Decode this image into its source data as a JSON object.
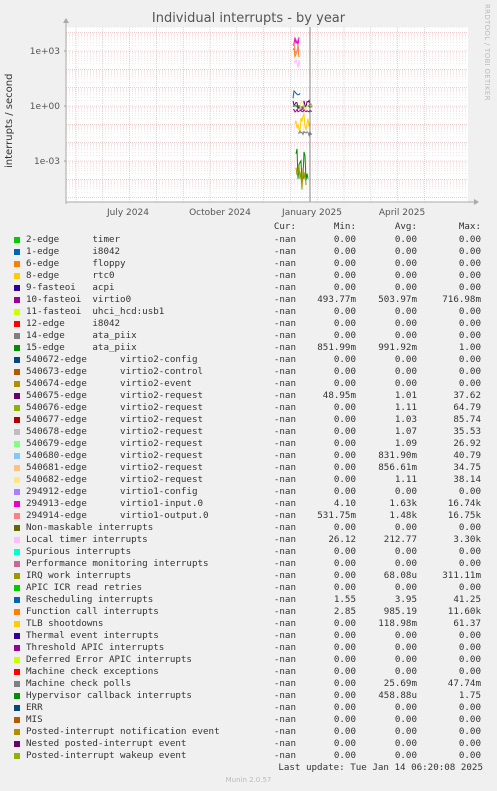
{
  "title": "Individual interrupts - by year",
  "ylabel": "interrupts / second",
  "side_label": "RRDTOOL / TOBI OETIKER",
  "header": {
    "cur": "Cur:",
    "min": "Min:",
    "avg": "Avg:",
    "max": "Max:"
  },
  "last_update": "Last update: Tue Jan 14 06:20:08 2025",
  "munin": "Munin 2.0.57",
  "chart_data": {
    "type": "line",
    "title": "Individual interrupts - by year",
    "ylabel": "interrupts / second",
    "yscale": "log",
    "ylim": [
      5e-05,
      100000
    ],
    "yticks": [
      "1e+03",
      "1e+00",
      "1e-03"
    ],
    "xticks": [
      "July 2024",
      "October 2024",
      "January 2025",
      "April 2025"
    ],
    "grid": true,
    "series": [
      {
        "name": "2-edge timer",
        "color": "#00cc00",
        "cur": "-nan",
        "min": "0.00",
        "avg": "0.00",
        "max": "0.00"
      },
      {
        "name": "1-edge i8042",
        "color": "#0066b3",
        "cur": "-nan",
        "min": "0.00",
        "avg": "0.00",
        "max": "0.00"
      },
      {
        "name": "6-edge floppy",
        "color": "#ff8000",
        "cur": "-nan",
        "min": "0.00",
        "avg": "0.00",
        "max": "0.00"
      },
      {
        "name": "8-edge rtc0",
        "color": "#ffcc00",
        "cur": "-nan",
        "min": "0.00",
        "avg": "0.00",
        "max": "0.00"
      },
      {
        "name": "9-fasteoi acpi",
        "color": "#330099",
        "cur": "-nan",
        "min": "0.00",
        "avg": "0.00",
        "max": "0.00"
      },
      {
        "name": "10-fasteoi virtio0",
        "color": "#990099",
        "cur": "-nan",
        "min": "493.77m",
        "avg": "503.97m",
        "max": "716.98m"
      },
      {
        "name": "11-fasteoi uhci_hcd:usb1",
        "color": "#ccff00",
        "cur": "-nan",
        "min": "0.00",
        "avg": "0.00",
        "max": "0.00"
      },
      {
        "name": "12-edge i8042",
        "color": "#ff0000",
        "cur": "-nan",
        "min": "0.00",
        "avg": "0.00",
        "max": "0.00"
      },
      {
        "name": "14-edge ata_piix",
        "color": "#808080",
        "cur": "-nan",
        "min": "0.00",
        "avg": "0.00",
        "max": "0.00"
      },
      {
        "name": "15-edge ata_piix",
        "color": "#008f00",
        "cur": "-nan",
        "min": "851.99m",
        "avg": "991.92m",
        "max": "1.00"
      },
      {
        "name": "540672-edge virtio2-config",
        "color": "#00487d",
        "cur": "-nan",
        "min": "0.00",
        "avg": "0.00",
        "max": "0.00"
      },
      {
        "name": "540673-edge virtio2-control",
        "color": "#b35a00",
        "cur": "-nan",
        "min": "0.00",
        "avg": "0.00",
        "max": "0.00"
      },
      {
        "name": "540674-edge virtio2-event",
        "color": "#b38f00",
        "cur": "-nan",
        "min": "0.00",
        "avg": "0.00",
        "max": "0.00"
      },
      {
        "name": "540675-edge virtio2-request",
        "color": "#6b006b",
        "cur": "-nan",
        "min": "48.95m",
        "avg": "1.01",
        "max": "37.62"
      },
      {
        "name": "540676-edge virtio2-request",
        "color": "#8fb300",
        "cur": "-nan",
        "min": "0.00",
        "avg": "1.11",
        "max": "64.79"
      },
      {
        "name": "540677-edge virtio2-request",
        "color": "#b30000",
        "cur": "-nan",
        "min": "0.00",
        "avg": "1.03",
        "max": "85.74"
      },
      {
        "name": "540678-edge virtio2-request",
        "color": "#bebebe",
        "cur": "-nan",
        "min": "0.00",
        "avg": "1.07",
        "max": "35.53"
      },
      {
        "name": "540679-edge virtio2-request",
        "color": "#80ff80",
        "cur": "-nan",
        "min": "0.00",
        "avg": "1.09",
        "max": "26.92"
      },
      {
        "name": "540680-edge virtio2-request",
        "color": "#80c9ff",
        "cur": "-nan",
        "min": "0.00",
        "avg": "831.90m",
        "max": "40.79"
      },
      {
        "name": "540681-edge virtio2-request",
        "color": "#ffc080",
        "cur": "-nan",
        "min": "0.00",
        "avg": "856.61m",
        "max": "34.75"
      },
      {
        "name": "540682-edge virtio2-request",
        "color": "#ffe680",
        "cur": "-nan",
        "min": "0.00",
        "avg": "1.11",
        "max": "38.14"
      },
      {
        "name": "294912-edge virtio1-config",
        "color": "#aa80ff",
        "cur": "-nan",
        "min": "0.00",
        "avg": "0.00",
        "max": "0.00"
      },
      {
        "name": "294913-edge virtio1-input.0",
        "color": "#ee00cc",
        "cur": "-nan",
        "min": "4.10",
        "avg": "1.63k",
        "max": "16.74k"
      },
      {
        "name": "294914-edge virtio1-output.0",
        "color": "#ff8080",
        "cur": "-nan",
        "min": "531.75m",
        "avg": "1.48k",
        "max": "16.75k"
      },
      {
        "name": "Non-maskable interrupts",
        "color": "#666600",
        "cur": "-nan",
        "min": "0.00",
        "avg": "0.00",
        "max": "0.00"
      },
      {
        "name": "Local timer interrupts",
        "color": "#ffbfff",
        "cur": "-nan",
        "min": "26.12",
        "avg": "212.77",
        "max": "3.30k"
      },
      {
        "name": "Spurious interrupts",
        "color": "#00ffcc",
        "cur": "-nan",
        "min": "0.00",
        "avg": "0.00",
        "max": "0.00"
      },
      {
        "name": "Performance monitoring interrupts",
        "color": "#cc6699",
        "cur": "-nan",
        "min": "0.00",
        "avg": "0.00",
        "max": "0.00"
      },
      {
        "name": "IRQ work interrupts",
        "color": "#999900",
        "cur": "-nan",
        "min": "0.00",
        "avg": "68.08u",
        "max": "311.11m"
      },
      {
        "name": "APIC ICR read retries",
        "color": "#00cc00",
        "cur": "-nan",
        "min": "0.00",
        "avg": "0.00",
        "max": "0.00"
      },
      {
        "name": "Rescheduling interrupts",
        "color": "#0066b3",
        "cur": "-nan",
        "min": "1.55",
        "avg": "3.95",
        "max": "41.25"
      },
      {
        "name": "Function call interrupts",
        "color": "#ff8000",
        "cur": "-nan",
        "min": "2.85",
        "avg": "985.19",
        "max": "11.60k"
      },
      {
        "name": "TLB shootdowns",
        "color": "#ffcc00",
        "cur": "-nan",
        "min": "0.00",
        "avg": "118.98m",
        "max": "61.37"
      },
      {
        "name": "Thermal event interrupts",
        "color": "#330099",
        "cur": "-nan",
        "min": "0.00",
        "avg": "0.00",
        "max": "0.00"
      },
      {
        "name": "Threshold APIC interrupts",
        "color": "#990099",
        "cur": "-nan",
        "min": "0.00",
        "avg": "0.00",
        "max": "0.00"
      },
      {
        "name": "Deferred Error APIC interrupts",
        "color": "#ccff00",
        "cur": "-nan",
        "min": "0.00",
        "avg": "0.00",
        "max": "0.00"
      },
      {
        "name": "Machine check exceptions",
        "color": "#ff0000",
        "cur": "-nan",
        "min": "0.00",
        "avg": "0.00",
        "max": "0.00"
      },
      {
        "name": "Machine check polls",
        "color": "#808080",
        "cur": "-nan",
        "min": "0.00",
        "avg": "25.69m",
        "max": "47.74m"
      },
      {
        "name": "Hypervisor callback interrupts",
        "color": "#008f00",
        "cur": "-nan",
        "min": "0.00",
        "avg": "458.88u",
        "max": "1.75"
      },
      {
        "name": "ERR",
        "color": "#00487d",
        "cur": "-nan",
        "min": "0.00",
        "avg": "0.00",
        "max": "0.00"
      },
      {
        "name": "MIS",
        "color": "#b35a00",
        "cur": "-nan",
        "min": "0.00",
        "avg": "0.00",
        "max": "0.00"
      },
      {
        "name": "Posted-interrupt notification event",
        "color": "#b38f00",
        "cur": "-nan",
        "min": "0.00",
        "avg": "0.00",
        "max": "0.00"
      },
      {
        "name": "Nested posted-interrupt event",
        "color": "#6b006b",
        "cur": "-nan",
        "min": "0.00",
        "avg": "0.00",
        "max": "0.00"
      },
      {
        "name": "Posted-interrupt wakeup event",
        "color": "#8fb300",
        "cur": "-nan",
        "min": "0.00",
        "avg": "0.00",
        "max": "0.00"
      }
    ]
  }
}
